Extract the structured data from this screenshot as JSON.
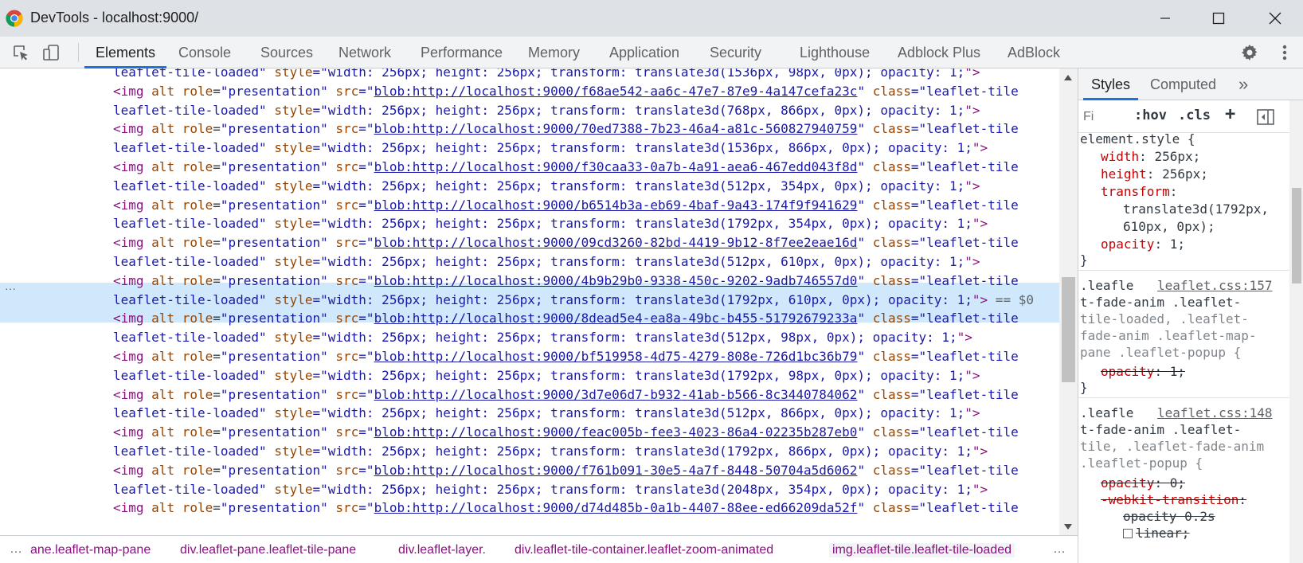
{
  "window": {
    "title": "DevTools - localhost:9000/"
  },
  "toolbar": {
    "tabs": [
      {
        "label": "Elements",
        "active": true
      },
      {
        "label": "Console"
      },
      {
        "label": "Sources"
      },
      {
        "label": "Network"
      },
      {
        "label": "Performance"
      },
      {
        "label": "Memory"
      },
      {
        "label": "Application"
      },
      {
        "label": "Security"
      },
      {
        "label": "Lighthouse"
      },
      {
        "label": "Adblock Plus"
      },
      {
        "label": "AdBlock"
      }
    ]
  },
  "tree": {
    "lines": [
      {
        "kind": "cont",
        "cls": "leaflet-tile-loaded",
        "style": "width: 256px; height: 256px; transform: translate3d(1536px, 98px, 0px); opacity: 1;"
      },
      {
        "kind": "img",
        "src": "blob:http://localhost:9000/f68ae542-aa6c-47e7-87e9-4a147cefa23c",
        "cls": "leaflet-tile"
      },
      {
        "kind": "cont",
        "cls": "leaflet-tile-loaded",
        "style": "width: 256px; height: 256px; transform: translate3d(768px, 866px, 0px); opacity: 1;"
      },
      {
        "kind": "img",
        "src": "blob:http://localhost:9000/70ed7388-7b23-46a4-a81c-560827940759",
        "cls": "leaflet-tile"
      },
      {
        "kind": "cont",
        "cls": "leaflet-tile-loaded",
        "style": "width: 256px; height: 256px; transform: translate3d(1536px, 866px, 0px); opacity: 1;"
      },
      {
        "kind": "img",
        "src": "blob:http://localhost:9000/f30caa33-0a7b-4a91-aea6-467edd043f8d",
        "cls": "leaflet-tile"
      },
      {
        "kind": "cont",
        "cls": "leaflet-tile-loaded",
        "style": "width: 256px; height: 256px; transform: translate3d(512px, 354px, 0px); opacity: 1;"
      },
      {
        "kind": "img",
        "src": "blob:http://localhost:9000/b6514b3a-eb69-4baf-9a43-174f9f941629",
        "cls": "leaflet-tile"
      },
      {
        "kind": "cont",
        "cls": "leaflet-tile-loaded",
        "style": "width: 256px; height: 256px; transform: translate3d(1792px, 354px, 0px); opacity: 1;"
      },
      {
        "kind": "img",
        "src": "blob:http://localhost:9000/09cd3260-82bd-4419-9b12-8f7ee2eae16d",
        "cls": "leaflet-tile"
      },
      {
        "kind": "cont",
        "cls": "leaflet-tile-loaded",
        "style": "width: 256px; height: 256px; transform: translate3d(512px, 610px, 0px); opacity: 1;"
      },
      {
        "kind": "img",
        "src": "blob:http://localhost:9000/4b9b29b0-9338-450c-9202-9adb746557d0",
        "cls": "leaflet-tile",
        "selected": true
      },
      {
        "kind": "cont",
        "cls": "leaflet-tile-loaded",
        "style": "width: 256px; height: 256px; transform: translate3d(1792px, 610px, 0px); opacity: 1;",
        "selected": true,
        "suffix": " == $0"
      },
      {
        "kind": "img",
        "src": "blob:http://localhost:9000/8dead5e4-ea8a-49bc-b455-51792679233a",
        "cls": "leaflet-tile"
      },
      {
        "kind": "cont",
        "cls": "leaflet-tile-loaded",
        "style": "width: 256px; height: 256px; transform: translate3d(512px, 98px, 0px); opacity: 1;"
      },
      {
        "kind": "img",
        "src": "blob:http://localhost:9000/bf519958-4d75-4279-808e-726d1bc36b79",
        "cls": "leaflet-tile"
      },
      {
        "kind": "cont",
        "cls": "leaflet-tile-loaded",
        "style": "width: 256px; height: 256px; transform: translate3d(1792px, 98px, 0px); opacity: 1;"
      },
      {
        "kind": "img",
        "src": "blob:http://localhost:9000/3d7e06d7-b932-41ab-b566-8c3440784062",
        "cls": "leaflet-tile"
      },
      {
        "kind": "cont",
        "cls": "leaflet-tile-loaded",
        "style": "width: 256px; height: 256px; transform: translate3d(512px, 866px, 0px); opacity: 1;"
      },
      {
        "kind": "img",
        "src": "blob:http://localhost:9000/feac005b-fee3-4023-86a4-02235b287eb0",
        "cls": "leaflet-tile"
      },
      {
        "kind": "cont",
        "cls": "leaflet-tile-loaded",
        "style": "width: 256px; height: 256px; transform: translate3d(1792px, 866px, 0px); opacity: 1;"
      },
      {
        "kind": "img",
        "src": "blob:http://localhost:9000/f761b091-30e5-4a7f-8448-50704a5d6062",
        "cls": "leaflet-tile"
      },
      {
        "kind": "cont",
        "cls": "leaflet-tile-loaded",
        "style": "width: 256px; height: 256px; transform: translate3d(2048px, 354px, 0px); opacity: 1;"
      },
      {
        "kind": "img",
        "src": "blob:http://localhost:9000/d74d485b-0a1b-4407-88ee-ed66209da52f",
        "cls": "leaflet-tile"
      }
    ],
    "tokens": {
      "img_open": "<img",
      "alt": "alt",
      "role_attr": "role",
      "role_val": "\"presentation\"",
      "src_attr": "src",
      "class_attr": "class",
      "style_attr": "style",
      "close": "\">"
    },
    "more_ellipsis": "···"
  },
  "breadcrumb": {
    "lead": "…",
    "items": [
      "ane.leaflet-map-pane",
      "div.leaflet-pane.leaflet-tile-pane",
      "div.leaflet-layer.",
      "div.leaflet-tile-container.leaflet-zoom-animated",
      "img.leaflet-tile.leaflet-tile-loaded"
    ],
    "trail": "…"
  },
  "styles": {
    "tabs": [
      {
        "label": "Styles",
        "active": true
      },
      {
        "label": "Computed"
      }
    ],
    "more": "»",
    "filter_placeholder": "Fi",
    "hov": ":hov",
    "cls": ".cls",
    "plus": "+",
    "element_style": {
      "selector": "element.style {",
      "props": [
        {
          "name": "width",
          "value": "256px;"
        },
        {
          "name": "height",
          "value": "256px;"
        },
        {
          "name": "transform",
          "value": ""
        },
        {
          "name": "",
          "value": "translate3d(1792px,"
        },
        {
          "name": "",
          "value": "610px, 0px);"
        },
        {
          "name": "opacity",
          "value": "1;"
        }
      ],
      "close": "}"
    },
    "rule2": {
      "sel_lines": [
        ".leafle",
        "t-fade-anim .leaflet-",
        "tile-loaded, .leaflet-",
        "fade-anim .leaflet-map-",
        "pane .leaflet-popup {"
      ],
      "source": "leaflet.css:157",
      "prop": "opacity",
      "value": "1;",
      "close": "}"
    },
    "rule3": {
      "sel_lines": [
        ".leafle",
        "t-fade-anim .leaflet-",
        "tile, .leaflet-fade-anim",
        ".leaflet-popup {"
      ],
      "source": "leaflet.css:148",
      "props": [
        {
          "name": "opacity",
          "value": "0;"
        },
        {
          "name": "-webkit-transition",
          "value": ""
        },
        {
          "name": "",
          "value": "opacity 0.2s"
        },
        {
          "name": "",
          "value": "linear;"
        }
      ]
    }
  }
}
